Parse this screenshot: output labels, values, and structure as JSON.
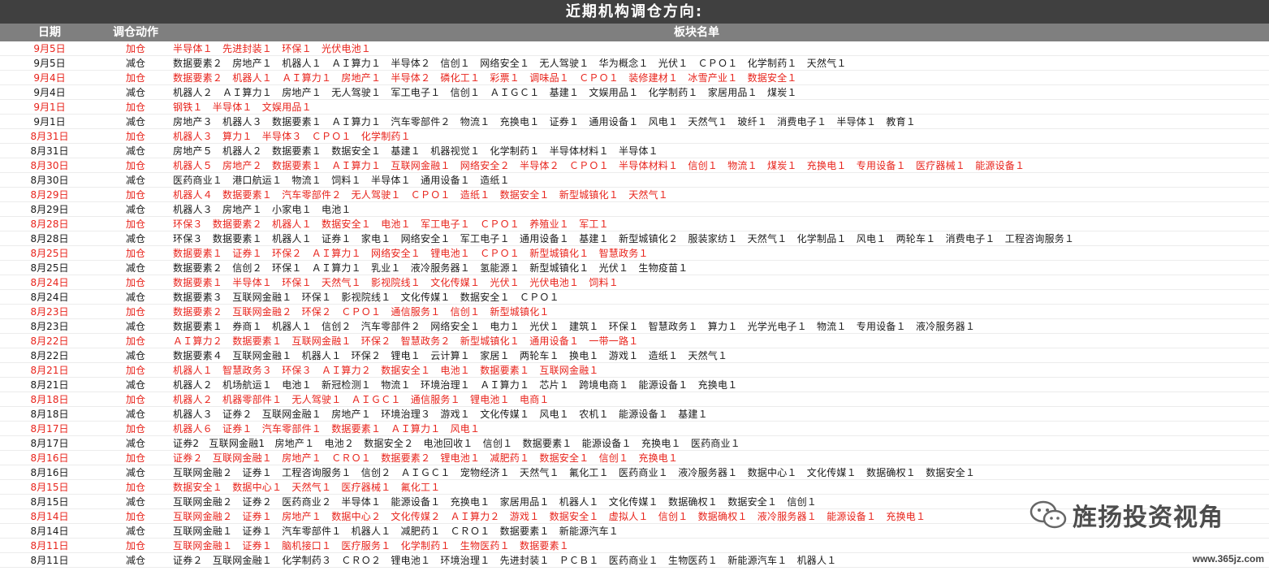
{
  "title": "近期机构调仓方向:",
  "header": {
    "date": "日期",
    "action": "调仓动作",
    "list": "板块名单"
  },
  "rows": [
    {
      "date": "9月5日",
      "action": "加仓",
      "list": "半导体１　先进封装１　环保１　光伏电池１",
      "color": "red"
    },
    {
      "date": "9月5日",
      "action": "减仓",
      "list": "数据要素２　房地产１　机器人１　ＡＩ算力１　半导体２　信创１　网络安全１　无人驾驶１　华为概念１　光伏１　ＣＰＯ１　化学制药１　天然气１",
      "color": "black"
    },
    {
      "date": "9月4日",
      "action": "加仓",
      "list": "数据要素２　机器人１　ＡＩ算力１　房地产１　半导体２　磷化工１　彩票１　调味品１　ＣＰＯ１　装修建材１　冰雪产业１　数据安全１",
      "color": "red"
    },
    {
      "date": "9月4日",
      "action": "减仓",
      "list": "机器人２　ＡＩ算力１　房地产１　无人驾驶１　军工电子１　信创１　ＡＩＧＣ１　基建１　文娱用品１　化学制药１　家居用品１　煤炭１",
      "color": "black"
    },
    {
      "date": "9月1日",
      "action": "加仓",
      "list": "钢铁１　半导体１　文娱用品１",
      "color": "red"
    },
    {
      "date": "9月1日",
      "action": "减仓",
      "list": "房地产３　机器人３　数据要素１　ＡＩ算力１　汽车零部件２　物流１　充换电１　证券１　通用设备１　风电１　天然气１　玻纤１　消费电子１　半导体１　教育１",
      "color": "black"
    },
    {
      "date": "8月31日",
      "action": "加仓",
      "list": "机器人３　算力１　半导体３　ＣＰＯ１　化学制药１",
      "color": "red"
    },
    {
      "date": "8月31日",
      "action": "减仓",
      "list": "房地产５　机器人２　数据要素１　数据安全１　基建１　机器视觉１　化学制药１　半导体材料１　半导体１",
      "color": "black"
    },
    {
      "date": "8月30日",
      "action": "加仓",
      "list": "机器人５　房地产２　数据要素１　ＡＩ算力１　互联网金融１　网络安全２　半导体２　ＣＰＯ１　半导体材料１　信创１　物流１　煤炭１　充换电１　专用设备１　医疗器械１　能源设备１",
      "color": "red"
    },
    {
      "date": "8月30日",
      "action": "减仓",
      "list": "医药商业１　港口航运１　物流１　饲料１　半导体１　通用设备１　造纸１",
      "color": "black"
    },
    {
      "date": "8月29日",
      "action": "加仓",
      "list": "机器人４　数据要素１　汽车零部件２　无人驾驶１　ＣＰＯ１　造纸１　数据安全１　新型城镇化１　天然气１",
      "color": "red"
    },
    {
      "date": "8月29日",
      "action": "减仓",
      "list": "机器人３　房地产１　小家电１　电池１",
      "color": "black"
    },
    {
      "date": "8月28日",
      "action": "加仓",
      "list": "环保３　数据要素２　机器人１　数据安全１　电池１　军工电子１　ＣＰＯ１　养殖业１　军工１",
      "color": "red"
    },
    {
      "date": "8月28日",
      "action": "减仓",
      "list": "环保３　数据要素１　机器人１　证券１　家电１　网络安全１　军工电子１　通用设备１　基建１　新型城镇化２　服装家纺１　天然气１　化学制品１　风电１　两轮车１　消费电子１　工程咨询服务１",
      "color": "black"
    },
    {
      "date": "8月25日",
      "action": "加仓",
      "list": "数据要素１　证券１　环保２　ＡＩ算力１　网络安全１　锂电池１　ＣＰＯ１　新型城镇化１　智慧政务１",
      "color": "red"
    },
    {
      "date": "8月25日",
      "action": "减仓",
      "list": "数据要素２　信创２　环保１　ＡＩ算力１　乳业１　液冷服务器１　氢能源１　新型城镇化１　光伏１　生物疫苗１",
      "color": "black"
    },
    {
      "date": "8月24日",
      "action": "加仓",
      "list": "数据要素１　半导体１　环保１　天然气１　影视院线１　文化传媒１　光伏１　光伏电池１　饲料１",
      "color": "red"
    },
    {
      "date": "8月24日",
      "action": "减仓",
      "list": "数据要素３　互联网金融１　环保１　影视院线１　文化传媒１　数据安全１　ＣＰＯ１",
      "color": "black"
    },
    {
      "date": "8月23日",
      "action": "加仓",
      "list": "数据要素２　互联网金融２　环保２　ＣＰＯ１　通信服务１　信创１　新型城镇化１",
      "color": "red"
    },
    {
      "date": "8月23日",
      "action": "减仓",
      "list": "数据要素１　券商１　机器人１　信创２　汽车零部件２　网络安全１　电力１　光伏１　建筑１　环保１　智慧政务１　算力１　光学光电子１　物流１　专用设备１　液冷服务器１",
      "color": "black"
    },
    {
      "date": "8月22日",
      "action": "加仓",
      "list": "ＡＩ算力２　数据要素１　互联网金融１　环保２　智慧政务２　新型城镇化１　通用设备１　一带一路１",
      "color": "red"
    },
    {
      "date": "8月22日",
      "action": "减仓",
      "list": "数据要素４　互联网金融１　机器人１　环保２　锂电１　云计算１　家居１　两轮车１　换电１　游戏１　造纸１　天然气１",
      "color": "black"
    },
    {
      "date": "8月21日",
      "action": "加仓",
      "list": "机器人１　智慧政务３　环保３　ＡＩ算力２　数据安全１　电池１　数据要素１　互联网金融１",
      "color": "red"
    },
    {
      "date": "8月21日",
      "action": "减仓",
      "list": "机器人２　机场航运１　电池１　新冠检测１　物流１　环境治理１　ＡＩ算力１　芯片１　跨境电商１　能源设备１　充换电１",
      "color": "black"
    },
    {
      "date": "8月18日",
      "action": "加仓",
      "list": "机器人２　机器零部件１　无人驾驶１　ＡＩＧＣ１　通信服务１　锂电池１　电商１",
      "color": "red"
    },
    {
      "date": "8月18日",
      "action": "减仓",
      "list": "机器人３　证券２　互联网金融１　房地产１　环境治理３　游戏１　文化传媒１　风电１　农机１　能源设备１　基建１",
      "color": "black"
    },
    {
      "date": "8月17日",
      "action": "加仓",
      "list": "机器人６　证券１　汽车零部件１　数据要素１　ＡＩ算力１　风电１",
      "color": "red"
    },
    {
      "date": "8月17日",
      "action": "减仓",
      "list": "证券2　互联网金融1　房地产１　电池２　数据安全２　电池回收１　信创１　数据要素１　能源设备１　充换电１　医药商业１",
      "color": "black"
    },
    {
      "date": "8月16日",
      "action": "加仓",
      "list": "证券２　互联网金融１　房地产１　ＣＲＯ１　数据要素２　锂电池１　减肥药１　数据安全１　信创１　充换电１",
      "color": "red"
    },
    {
      "date": "8月16日",
      "action": "减仓",
      "list": "互联网金融２　证券１　工程咨询服务１　信创２　ＡＩＧＣ１　宠物经济１　天然气１　氟化工１　医药商业１　液冷服务器１　数据中心１　文化传媒１　数据确权１　数据安全１",
      "color": "black"
    },
    {
      "date": "8月15日",
      "action": "加仓",
      "list": "数据安全１　数据中心１　天然气１　医疗器械１　氟化工１",
      "color": "red"
    },
    {
      "date": "8月15日",
      "action": "减仓",
      "list": "互联网金融２　证券２　医药商业２　半导体１　能源设备１　充换电１　家居用品１　机器人１　文化传媒１　数据确权１　数据安全１　信创１",
      "color": "black"
    },
    {
      "date": "8月14日",
      "action": "加仓",
      "list": "互联网金融２　证券１　房地产１　数据中心２　文化传媒２　ＡＩ算力２　游戏１　数据安全１　虚拟人１　信创１　数据确权１　液冷服务器１　能源设备１　充换电１",
      "color": "red"
    },
    {
      "date": "8月14日",
      "action": "减仓",
      "list": "互联网金融１　证券１　汽车零部件１　机器人１　减肥药１　ＣＲＯ１　数据要素１　新能源汽车１",
      "color": "black"
    },
    {
      "date": "8月11日",
      "action": "加仓",
      "list": "互联网金融１　证券１　脑机接口１　医疗服务１　化学制药１　生物医药１　数据要素１",
      "color": "red"
    },
    {
      "date": "8月11日",
      "action": "减仓",
      "list": "证券２　互联网金融１　化学制药３　ＣＲＯ２　锂电池１　环境治理１　先进封装１　ＰＣＢ１　医药商业１　生物医药１　新能源汽车１　机器人１",
      "color": "black"
    }
  ],
  "watermark": {
    "text": "旌扬投资视角",
    "icon": "wechat-icon",
    "site": "www.365jz.com"
  }
}
